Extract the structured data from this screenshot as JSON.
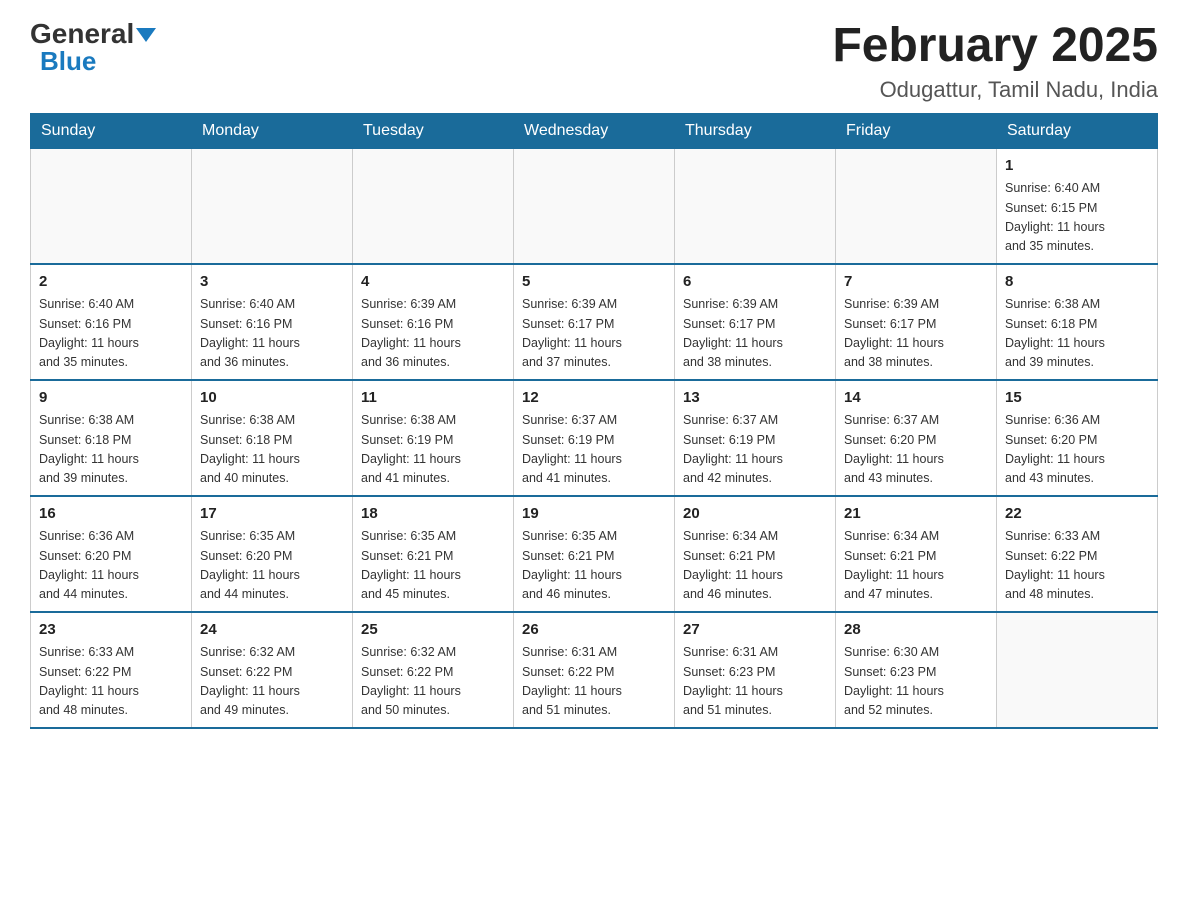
{
  "header": {
    "logo_general": "General",
    "logo_blue": "Blue",
    "title": "February 2025",
    "subtitle": "Odugattur, Tamil Nadu, India"
  },
  "weekdays": [
    "Sunday",
    "Monday",
    "Tuesday",
    "Wednesday",
    "Thursday",
    "Friday",
    "Saturday"
  ],
  "weeks": [
    [
      {
        "day": "",
        "info": ""
      },
      {
        "day": "",
        "info": ""
      },
      {
        "day": "",
        "info": ""
      },
      {
        "day": "",
        "info": ""
      },
      {
        "day": "",
        "info": ""
      },
      {
        "day": "",
        "info": ""
      },
      {
        "day": "1",
        "info": "Sunrise: 6:40 AM\nSunset: 6:15 PM\nDaylight: 11 hours\nand 35 minutes."
      }
    ],
    [
      {
        "day": "2",
        "info": "Sunrise: 6:40 AM\nSunset: 6:16 PM\nDaylight: 11 hours\nand 35 minutes."
      },
      {
        "day": "3",
        "info": "Sunrise: 6:40 AM\nSunset: 6:16 PM\nDaylight: 11 hours\nand 36 minutes."
      },
      {
        "day": "4",
        "info": "Sunrise: 6:39 AM\nSunset: 6:16 PM\nDaylight: 11 hours\nand 36 minutes."
      },
      {
        "day": "5",
        "info": "Sunrise: 6:39 AM\nSunset: 6:17 PM\nDaylight: 11 hours\nand 37 minutes."
      },
      {
        "day": "6",
        "info": "Sunrise: 6:39 AM\nSunset: 6:17 PM\nDaylight: 11 hours\nand 38 minutes."
      },
      {
        "day": "7",
        "info": "Sunrise: 6:39 AM\nSunset: 6:17 PM\nDaylight: 11 hours\nand 38 minutes."
      },
      {
        "day": "8",
        "info": "Sunrise: 6:38 AM\nSunset: 6:18 PM\nDaylight: 11 hours\nand 39 minutes."
      }
    ],
    [
      {
        "day": "9",
        "info": "Sunrise: 6:38 AM\nSunset: 6:18 PM\nDaylight: 11 hours\nand 39 minutes."
      },
      {
        "day": "10",
        "info": "Sunrise: 6:38 AM\nSunset: 6:18 PM\nDaylight: 11 hours\nand 40 minutes."
      },
      {
        "day": "11",
        "info": "Sunrise: 6:38 AM\nSunset: 6:19 PM\nDaylight: 11 hours\nand 41 minutes."
      },
      {
        "day": "12",
        "info": "Sunrise: 6:37 AM\nSunset: 6:19 PM\nDaylight: 11 hours\nand 41 minutes."
      },
      {
        "day": "13",
        "info": "Sunrise: 6:37 AM\nSunset: 6:19 PM\nDaylight: 11 hours\nand 42 minutes."
      },
      {
        "day": "14",
        "info": "Sunrise: 6:37 AM\nSunset: 6:20 PM\nDaylight: 11 hours\nand 43 minutes."
      },
      {
        "day": "15",
        "info": "Sunrise: 6:36 AM\nSunset: 6:20 PM\nDaylight: 11 hours\nand 43 minutes."
      }
    ],
    [
      {
        "day": "16",
        "info": "Sunrise: 6:36 AM\nSunset: 6:20 PM\nDaylight: 11 hours\nand 44 minutes."
      },
      {
        "day": "17",
        "info": "Sunrise: 6:35 AM\nSunset: 6:20 PM\nDaylight: 11 hours\nand 44 minutes."
      },
      {
        "day": "18",
        "info": "Sunrise: 6:35 AM\nSunset: 6:21 PM\nDaylight: 11 hours\nand 45 minutes."
      },
      {
        "day": "19",
        "info": "Sunrise: 6:35 AM\nSunset: 6:21 PM\nDaylight: 11 hours\nand 46 minutes."
      },
      {
        "day": "20",
        "info": "Sunrise: 6:34 AM\nSunset: 6:21 PM\nDaylight: 11 hours\nand 46 minutes."
      },
      {
        "day": "21",
        "info": "Sunrise: 6:34 AM\nSunset: 6:21 PM\nDaylight: 11 hours\nand 47 minutes."
      },
      {
        "day": "22",
        "info": "Sunrise: 6:33 AM\nSunset: 6:22 PM\nDaylight: 11 hours\nand 48 minutes."
      }
    ],
    [
      {
        "day": "23",
        "info": "Sunrise: 6:33 AM\nSunset: 6:22 PM\nDaylight: 11 hours\nand 48 minutes."
      },
      {
        "day": "24",
        "info": "Sunrise: 6:32 AM\nSunset: 6:22 PM\nDaylight: 11 hours\nand 49 minutes."
      },
      {
        "day": "25",
        "info": "Sunrise: 6:32 AM\nSunset: 6:22 PM\nDaylight: 11 hours\nand 50 minutes."
      },
      {
        "day": "26",
        "info": "Sunrise: 6:31 AM\nSunset: 6:22 PM\nDaylight: 11 hours\nand 51 minutes."
      },
      {
        "day": "27",
        "info": "Sunrise: 6:31 AM\nSunset: 6:23 PM\nDaylight: 11 hours\nand 51 minutes."
      },
      {
        "day": "28",
        "info": "Sunrise: 6:30 AM\nSunset: 6:23 PM\nDaylight: 11 hours\nand 52 minutes."
      },
      {
        "day": "",
        "info": ""
      }
    ]
  ]
}
